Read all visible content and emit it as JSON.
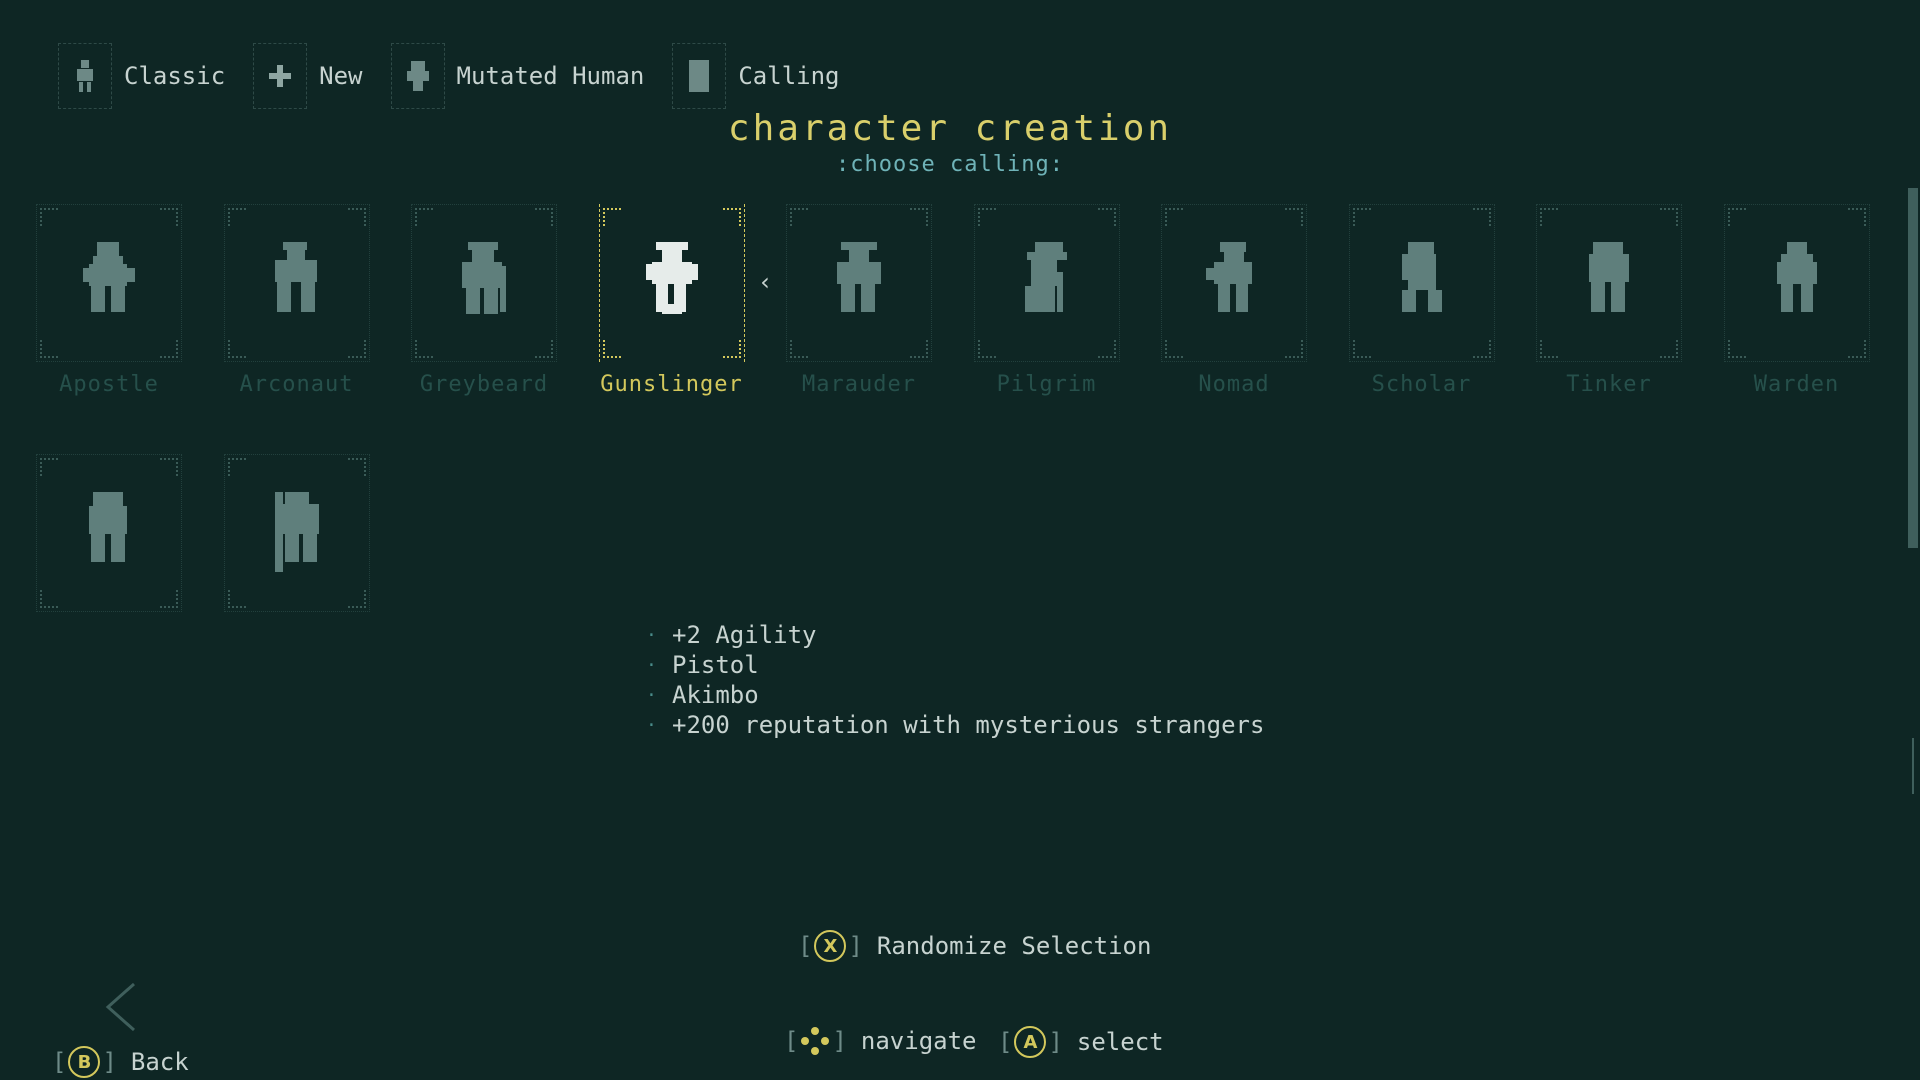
{
  "breadcrumb": [
    {
      "label": "Classic",
      "icon": "figure-icon"
    },
    {
      "label": "New",
      "icon": "plus-icon"
    },
    {
      "label": "Mutated Human",
      "icon": "mutant-icon"
    },
    {
      "label": "Calling",
      "icon": "card-icon"
    }
  ],
  "title": "character creation",
  "subtitle": ":choose calling:",
  "callings": [
    {
      "label": "Apostle"
    },
    {
      "label": "Arconaut"
    },
    {
      "label": "Greybeard"
    },
    {
      "label": "Gunslinger",
      "selected": true
    },
    {
      "label": "Marauder"
    },
    {
      "label": "Pilgrim"
    },
    {
      "label": "Nomad"
    },
    {
      "label": "Scholar"
    },
    {
      "label": "Tinker"
    },
    {
      "label": "Warden"
    },
    {
      "label": ""
    },
    {
      "label": ""
    }
  ],
  "description": [
    "+2 Agility",
    "Pistol",
    "Akimbo",
    "+200 reputation with mysterious strangers"
  ],
  "controls": {
    "randomize_key": "X",
    "randomize_label": "Randomize Selection",
    "navigate_label": "navigate",
    "select_key": "A",
    "select_label": "select",
    "back_key": "B",
    "back_label": "Back",
    "open_bracket": "[",
    "close_bracket": "]"
  },
  "colors": {
    "background": "#0e2624",
    "accent_yellow": "#d3c85c",
    "subtitle_teal": "#6fb3b8",
    "sprite": "#5f7f7c",
    "sprite_selected": "#e6ecea"
  }
}
